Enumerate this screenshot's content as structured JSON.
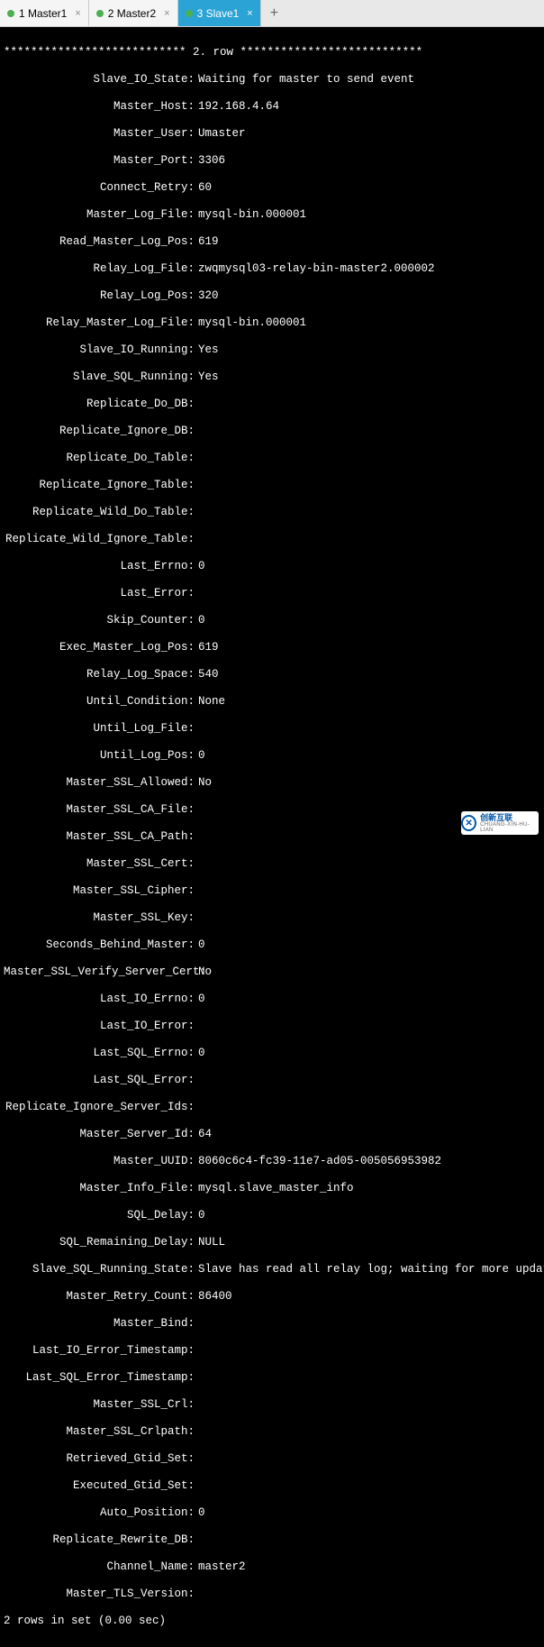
{
  "tabs": [
    {
      "label": "1 Master1"
    },
    {
      "label": "2 Master2"
    },
    {
      "label": "3 Slave1"
    }
  ],
  "tab_add": "+",
  "tab_close": "×",
  "row_header": "*************************** 2. row ***************************",
  "status": {
    "Slave_IO_State": "Waiting for master to send event",
    "Master_Host": "192.168.4.64",
    "Master_User": "Umaster",
    "Master_Port": "3306",
    "Connect_Retry": "60",
    "Master_Log_File": "mysql-bin.000001",
    "Read_Master_Log_Pos": "619",
    "Relay_Log_File": "zwqmysql03-relay-bin-master2.000002",
    "Relay_Log_Pos": "320",
    "Relay_Master_Log_File": "mysql-bin.000001",
    "Slave_IO_Running": "Yes",
    "Slave_SQL_Running": "Yes",
    "Replicate_Do_DB": "",
    "Replicate_Ignore_DB": "",
    "Replicate_Do_Table": "",
    "Replicate_Ignore_Table": "",
    "Replicate_Wild_Do_Table": "",
    "Replicate_Wild_Ignore_Table": "",
    "Last_Errno": "0",
    "Last_Error": "",
    "Skip_Counter": "0",
    "Exec_Master_Log_Pos": "619",
    "Relay_Log_Space": "540",
    "Until_Condition": "None",
    "Until_Log_File": "",
    "Until_Log_Pos": "0",
    "Master_SSL_Allowed": "No",
    "Master_SSL_CA_File": "",
    "Master_SSL_CA_Path": "",
    "Master_SSL_Cert": "",
    "Master_SSL_Cipher": "",
    "Master_SSL_Key": "",
    "Seconds_Behind_Master": "0",
    "Master_SSL_Verify_Server_Cert": "No",
    "Last_IO_Errno": "0",
    "Last_IO_Error": "",
    "Last_SQL_Errno": "0",
    "Last_SQL_Error": "",
    "Replicate_Ignore_Server_Ids": "",
    "Master_Server_Id": "64",
    "Master_UUID": "8060c6c4-fc39-11e7-ad05-005056953982",
    "Master_Info_File": "mysql.slave_master_info",
    "SQL_Delay": "0",
    "SQL_Remaining_Delay": "NULL",
    "Slave_SQL_Running_State": "Slave has read all relay log; waiting for more updates",
    "Master_Retry_Count": "86400",
    "Master_Bind": "",
    "Last_IO_Error_Timestamp": "",
    "Last_SQL_Error_Timestamp": "",
    "Master_SSL_Crl": "",
    "Master_SSL_Crlpath": "",
    "Retrieved_Gtid_Set": "",
    "Executed_Gtid_Set": "",
    "Auto_Position": "0",
    "Replicate_Rewrite_DB": "",
    "Channel_Name": "master2",
    "Master_TLS_Version": ""
  },
  "footer": "2 rows in set (0.00 sec)",
  "watermark": {
    "brand": "创新互联",
    "sub": "CHUANG-XIN-HU-LIAN"
  }
}
